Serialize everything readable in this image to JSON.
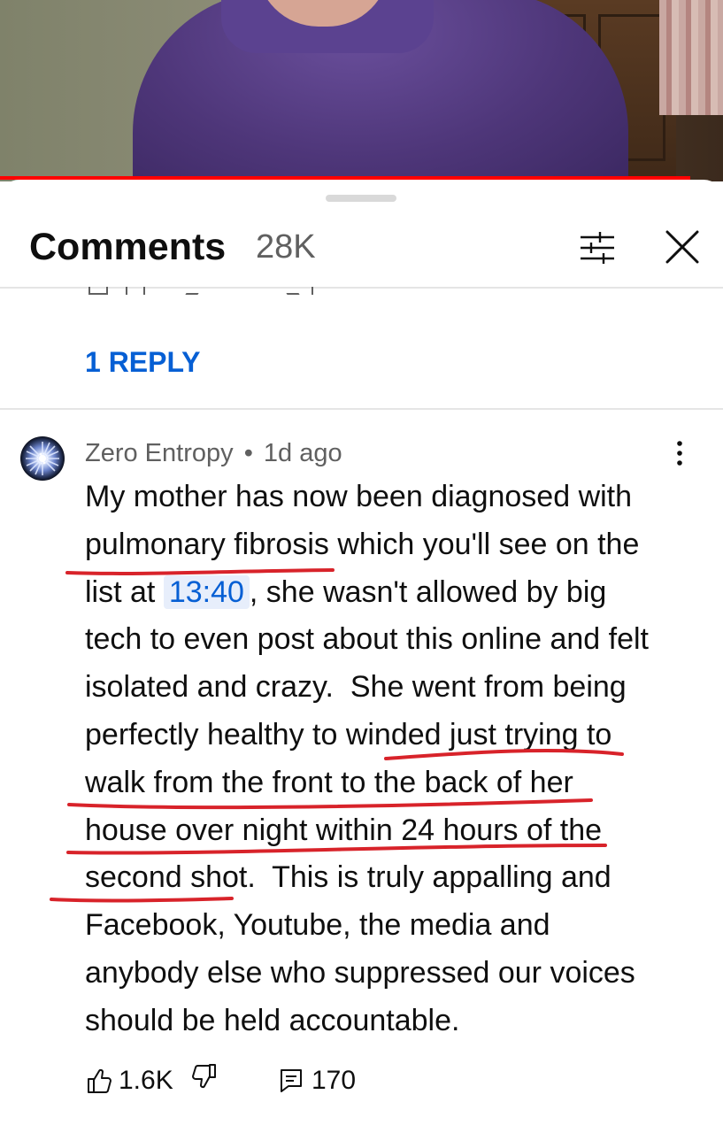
{
  "comments_header": {
    "title": "Comments",
    "count": "28K"
  },
  "previous_comment": {
    "reply_link": "1 REPLY"
  },
  "comment": {
    "author": "Zero Entropy",
    "separator": "•",
    "time": "1d ago",
    "lines": [
      "My mother has now been diagnosed with",
      "pulmonary fibrosis which you'll see on the",
      "list at ",
      "tech to even post about this online and felt",
      "isolated and crazy.  She went from being",
      "perfectly healthy to winded just trying to",
      "walk from the front to the back of her",
      "house over night within 24 hours of the",
      "second shot.  This is truly appalling and",
      "Facebook, Youtube, the media and",
      "anybody else who suppressed our voices",
      "should be held accountable."
    ],
    "timestamp_link": "13:40",
    "line3_rest": ", she wasn't allowed by big",
    "likes": "1.6K",
    "replies": "170"
  },
  "colors": {
    "accent_link": "#065fd4",
    "annotation_red": "#d8232a",
    "progress_red": "#ff0000"
  },
  "icons": [
    "filter-icon",
    "close-icon",
    "more-vertical-icon",
    "thumb-up-icon",
    "thumb-down-icon",
    "reply-icon"
  ]
}
